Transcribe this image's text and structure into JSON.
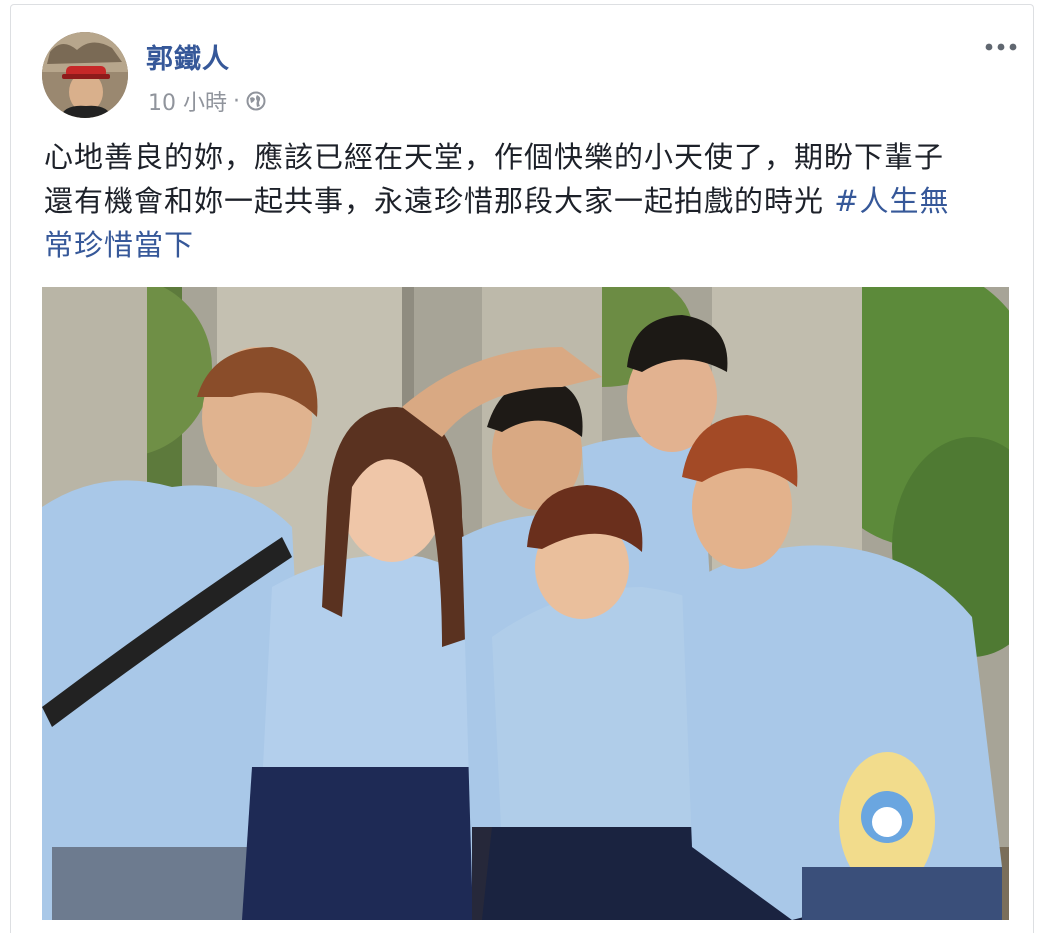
{
  "post": {
    "author": "郭鐵人",
    "time": "10 小時",
    "separator": "·",
    "text_line1": "心地善良的妳，應該已經在天堂，作個快樂的小天使了，期盼下輩子",
    "text_line2_prefix": "還有機會和妳一起共事，永遠珍惜那段大家一起拍戲的時光 ",
    "hashtag": "#人生無常珍惜當下",
    "hashtag_part1": "#人生無",
    "hashtag_part2": "常珍惜當下"
  },
  "icons": {
    "privacy": "globe-icon",
    "options": "more-options-icon"
  },
  "colors": {
    "link": "#365899",
    "meta": "#90949c",
    "text": "#1d2129",
    "shirt": "#a9c8e8",
    "skirt": "#1e2a55"
  }
}
